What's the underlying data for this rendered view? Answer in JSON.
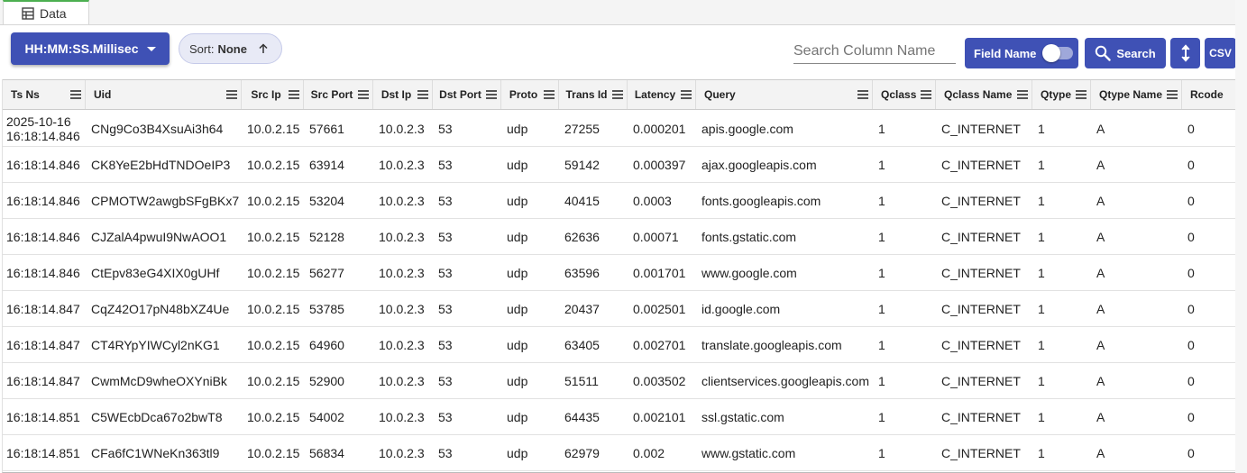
{
  "tabs": [
    {
      "label": "Data",
      "icon": "table-icon"
    }
  ],
  "toolbar": {
    "time_format_label": "HH:MM:SS.Millisec",
    "sort_label": "Sort:",
    "sort_value": "None",
    "search_placeholder": "Search Column Name",
    "field_name_label": "Field Name",
    "search_label": "Search",
    "csv_label": "CSV"
  },
  "columns": [
    "Ts Ns",
    "Uid",
    "Src Ip",
    "Src Port",
    "Dst Ip",
    "Dst Port",
    "Proto",
    "Trans Id",
    "Latency",
    "Query",
    "Qclass",
    "Qclass Name",
    "Qtype",
    "Qtype Name",
    "Rcode"
  ],
  "rows": [
    [
      "2025-10-16\n16:18:14.846",
      "CNg9Co3B4XsuAi3h64",
      "10.0.2.15",
      "57661",
      "10.0.2.3",
      "53",
      "udp",
      "27255",
      "0.000201",
      "apis.google.com",
      "1",
      "C_INTERNET",
      "1",
      "A",
      "0"
    ],
    [
      "16:18:14.846",
      "CK8YeE2bHdTNDOeIP3",
      "10.0.2.15",
      "63914",
      "10.0.2.3",
      "53",
      "udp",
      "59142",
      "0.000397",
      "ajax.googleapis.com",
      "1",
      "C_INTERNET",
      "1",
      "A",
      "0"
    ],
    [
      "16:18:14.846",
      "CPMOTW2awgbSFgBKx7",
      "10.0.2.15",
      "53204",
      "10.0.2.3",
      "53",
      "udp",
      "40415",
      "0.0003",
      "fonts.googleapis.com",
      "1",
      "C_INTERNET",
      "1",
      "A",
      "0"
    ],
    [
      "16:18:14.846",
      "CJZalA4pwuI9NwAOO1",
      "10.0.2.15",
      "52128",
      "10.0.2.3",
      "53",
      "udp",
      "62636",
      "0.00071",
      "fonts.gstatic.com",
      "1",
      "C_INTERNET",
      "1",
      "A",
      "0"
    ],
    [
      "16:18:14.846",
      "CtEpv83eG4XIX0gUHf",
      "10.0.2.15",
      "56277",
      "10.0.2.3",
      "53",
      "udp",
      "63596",
      "0.001701",
      "www.google.com",
      "1",
      "C_INTERNET",
      "1",
      "A",
      "0"
    ],
    [
      "16:18:14.847",
      "CqZ42O17pN48bXZ4Ue",
      "10.0.2.15",
      "53785",
      "10.0.2.3",
      "53",
      "udp",
      "20437",
      "0.002501",
      "id.google.com",
      "1",
      "C_INTERNET",
      "1",
      "A",
      "0"
    ],
    [
      "16:18:14.847",
      "CT4RYpYIWCyl2nKG1",
      "10.0.2.15",
      "64960",
      "10.0.2.3",
      "53",
      "udp",
      "63405",
      "0.002701",
      "translate.googleapis.com",
      "1",
      "C_INTERNET",
      "1",
      "A",
      "0"
    ],
    [
      "16:18:14.847",
      "CwmMcD9wheOXYniBk",
      "10.0.2.15",
      "52900",
      "10.0.2.3",
      "53",
      "udp",
      "51511",
      "0.003502",
      "clientservices.googleapis.com",
      "1",
      "C_INTERNET",
      "1",
      "A",
      "0"
    ],
    [
      "16:18:14.851",
      "C5WEcbDca67o2bwT8",
      "10.0.2.15",
      "54002",
      "10.0.2.3",
      "53",
      "udp",
      "64435",
      "0.002101",
      "ssl.gstatic.com",
      "1",
      "C_INTERNET",
      "1",
      "A",
      "0"
    ],
    [
      "16:18:14.851",
      "CFa6fC1WNeKn363tl9",
      "10.0.2.15",
      "56834",
      "10.0.2.3",
      "53",
      "udp",
      "62979",
      "0.002",
      "www.gstatic.com",
      "1",
      "C_INTERNET",
      "1",
      "A",
      "0"
    ]
  ]
}
